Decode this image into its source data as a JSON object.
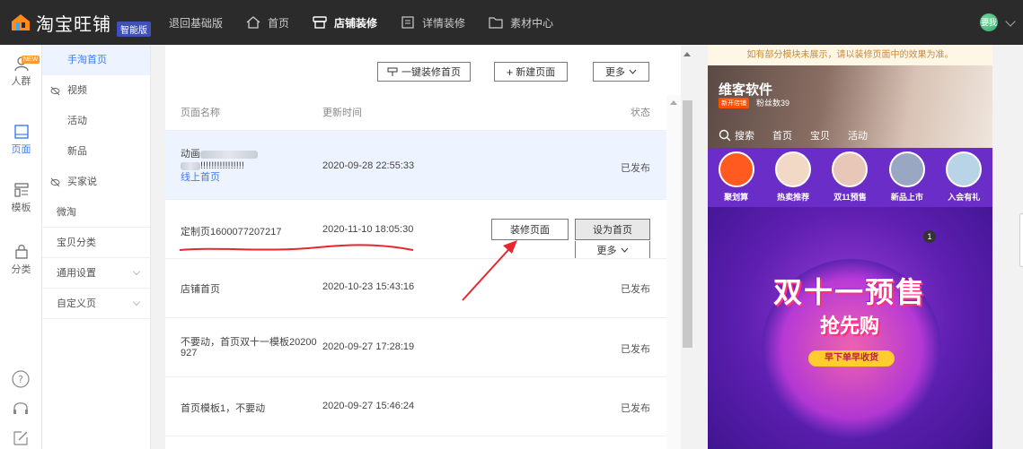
{
  "header": {
    "logo_text": "淘宝旺铺",
    "logo_badge": "智能版",
    "back_link": "退回基础版",
    "nav": [
      {
        "label": "首页",
        "icon": "home-icon"
      },
      {
        "label": "店铺装修",
        "icon": "shop-decor-icon",
        "active": true
      },
      {
        "label": "详情装修",
        "icon": "detail-icon"
      },
      {
        "label": "素材中心",
        "icon": "folder-icon"
      }
    ],
    "avatar_text": "要我"
  },
  "rail": {
    "new_badge": "NEW",
    "items": [
      {
        "label": "人群",
        "icon": "people-icon"
      },
      {
        "label": "页面",
        "icon": "page-icon",
        "active": true
      },
      {
        "label": "模板",
        "icon": "template-icon"
      },
      {
        "label": "分类",
        "icon": "bag-icon"
      }
    ]
  },
  "submenu": {
    "items": [
      {
        "label": "手淘首页",
        "type": "active"
      },
      {
        "label": "视频",
        "type": "group"
      },
      {
        "label": "活动",
        "type": "sub"
      },
      {
        "label": "新品",
        "type": "sub"
      },
      {
        "label": "买家说",
        "type": "group"
      },
      {
        "label": "微淘",
        "type": "plain"
      },
      {
        "label": "宝贝分类",
        "type": "plain"
      },
      {
        "label": "通用设置",
        "type": "expand"
      },
      {
        "label": "自定义页",
        "type": "expand"
      }
    ]
  },
  "toolbar": {
    "one_click": "一键装修首页",
    "new_page": "新建页面",
    "more": "更多"
  },
  "table": {
    "headers": {
      "name": "页面名称",
      "time": "更新时间",
      "status": "状态"
    },
    "rows": [
      {
        "name1": "动画",
        "name2": "!!!!!!!!!!!!!!!!",
        "tag": "线上首页",
        "time": "2020-09-28 22:55:33",
        "status": "已发布"
      },
      {
        "name1": "定制页1600077207217",
        "time": "2020-11-10 18:05:30",
        "action1": "装修页面",
        "action2": "设为首页",
        "action3": "更多"
      },
      {
        "name1": "店铺首页",
        "time": "2020-10-23 15:43:16",
        "status": "已发布"
      },
      {
        "name1": "不要动，首页双十一模板20200",
        "name2": "927",
        "time": "2020-09-27 17:28:19",
        "status": "已发布"
      },
      {
        "name1": "首页模板1，不要动",
        "time": "2020-09-27 15:46:24",
        "status": "已发布"
      }
    ]
  },
  "preview": {
    "notice": "如有部分模块未展示，请以装修页面中的效果为准。",
    "shop_name": "维客软件",
    "shop_tag": "新开店铺",
    "fans": "粉丝数39",
    "nav": [
      "搜索",
      "首页",
      "宝贝",
      "活动"
    ],
    "categories": [
      "聚划算",
      "热卖推荐",
      "双11预售",
      "新品上市",
      "入会有礼"
    ],
    "banner_title": "双十一预售",
    "banner_sub": "抢先购",
    "banner_pill": "早下单早收货",
    "banner_num": "1"
  },
  "colors": {
    "accent": "#3d7cf0",
    "topbar": "#2b2b2b",
    "annotation_red": "#e8262d"
  }
}
